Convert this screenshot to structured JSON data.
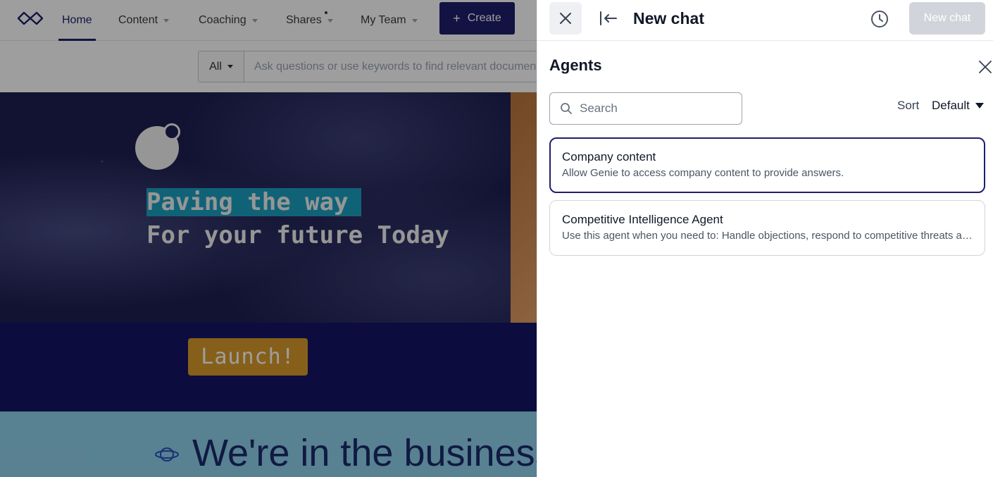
{
  "nav": {
    "items": [
      {
        "label": "Home",
        "active": true
      },
      {
        "label": "Content"
      },
      {
        "label": "Coaching"
      },
      {
        "label": "Shares"
      },
      {
        "label": "My Team"
      }
    ],
    "create_label": "Create",
    "accent_color": "#1e1f6b"
  },
  "search": {
    "scope": "All",
    "placeholder": "Ask questions or use keywords to find relevant documents"
  },
  "hero": {
    "line1": "Paving the way",
    "line2": "For your future Today",
    "launch_label": "Launch!",
    "business_text": "We're in the business of"
  },
  "panel": {
    "title": "New chat",
    "new_chat_label": "New chat",
    "agents_title": "Agents",
    "search_placeholder": "Search",
    "sort_label": "Sort",
    "sort_value": "Default",
    "agents": [
      {
        "name": "Company content",
        "description": "Allow Genie to access company content to provide answers.",
        "selected": true
      },
      {
        "name": "Competitive Intelligence Agent",
        "description": "Use this agent when you need to: Handle objections, respond to competitive threats and win deals against competitors",
        "selected": false
      }
    ]
  }
}
